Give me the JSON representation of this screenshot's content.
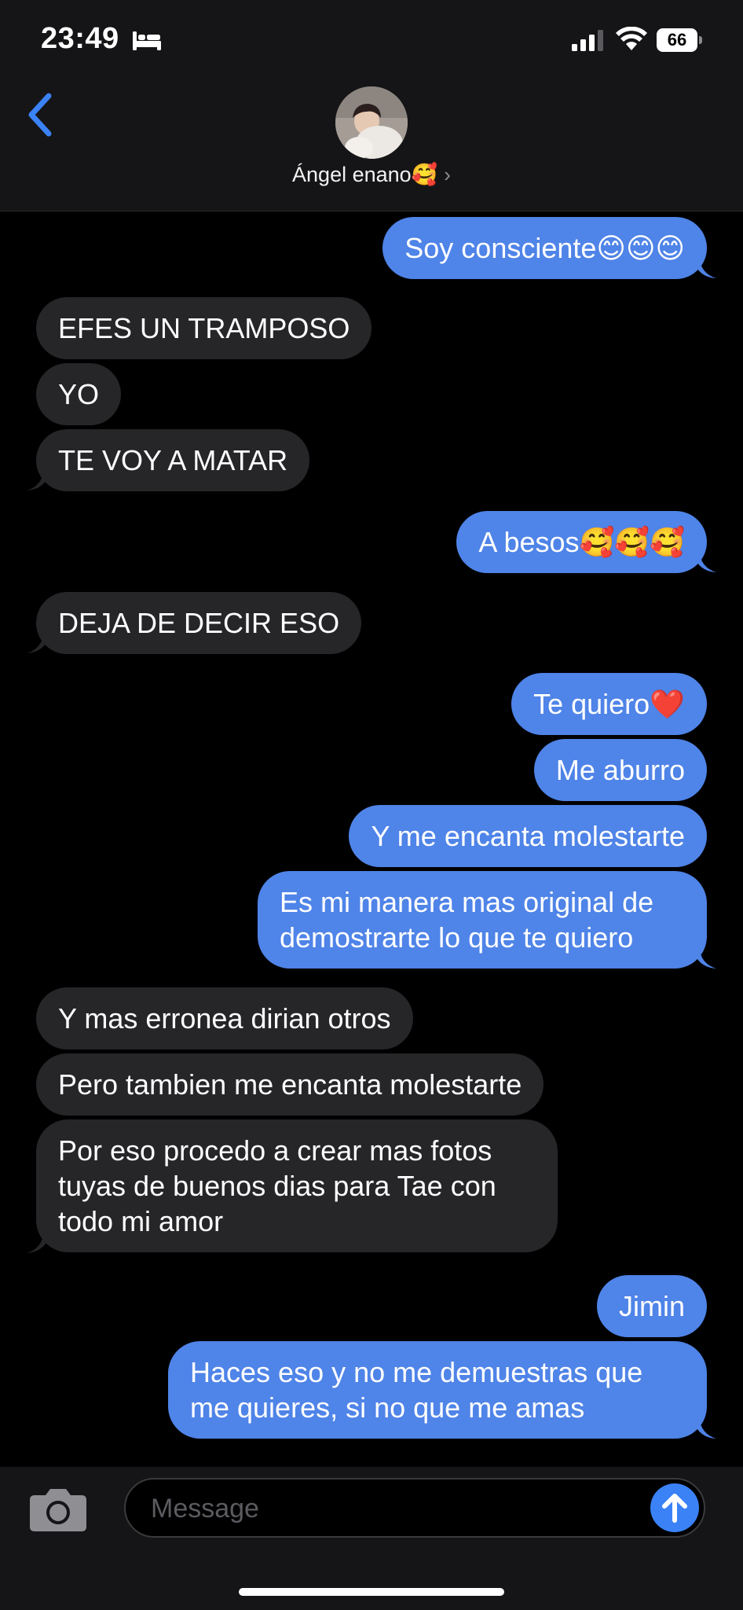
{
  "status_bar": {
    "time": "23:49",
    "battery": "66",
    "icons": [
      "bed-icon",
      "signal-icon",
      "wifi-icon",
      "battery-icon"
    ]
  },
  "header": {
    "back_icon": "chevron-left-icon",
    "contact_name": "Ángel enano🥰",
    "chevron": "›"
  },
  "messages": [
    {
      "dir": "out",
      "text": "Soy consciente😊😊😊"
    },
    {
      "dir": "in",
      "text": "EFES UN TRAMPOSO"
    },
    {
      "dir": "in",
      "text": "YO"
    },
    {
      "dir": "in",
      "text": "TE VOY A MATAR"
    },
    {
      "dir": "out",
      "text": "A besos🥰🥰🥰"
    },
    {
      "dir": "in",
      "text": "DEJA DE DECIR ESO"
    },
    {
      "dir": "out",
      "text": "Te quiero❤️"
    },
    {
      "dir": "out",
      "text": "Me aburro"
    },
    {
      "dir": "out",
      "text": "Y me encanta molestarte"
    },
    {
      "dir": "out",
      "text": "Es mi manera mas original de demostrarte lo que te quiero"
    },
    {
      "dir": "in",
      "text": "Y mas erronea dirian otros"
    },
    {
      "dir": "in",
      "text": "Pero tambien me encanta molestarte"
    },
    {
      "dir": "in",
      "text": "Por eso procedo a crear mas fotos tuyas de buenos dias para Tae con todo mi amor"
    },
    {
      "dir": "out",
      "text": "Jimin"
    },
    {
      "dir": "out",
      "text": "Haces eso y no me demuestras que me quieres, si no que me amas"
    }
  ],
  "composer": {
    "placeholder": "Message",
    "camera_icon": "camera-icon",
    "send_icon": "arrow-up-icon"
  },
  "colors": {
    "outgoing_bubble": "#4f84e8",
    "incoming_bubble": "#262629",
    "background": "#000000",
    "accent": "#3b82f6"
  }
}
